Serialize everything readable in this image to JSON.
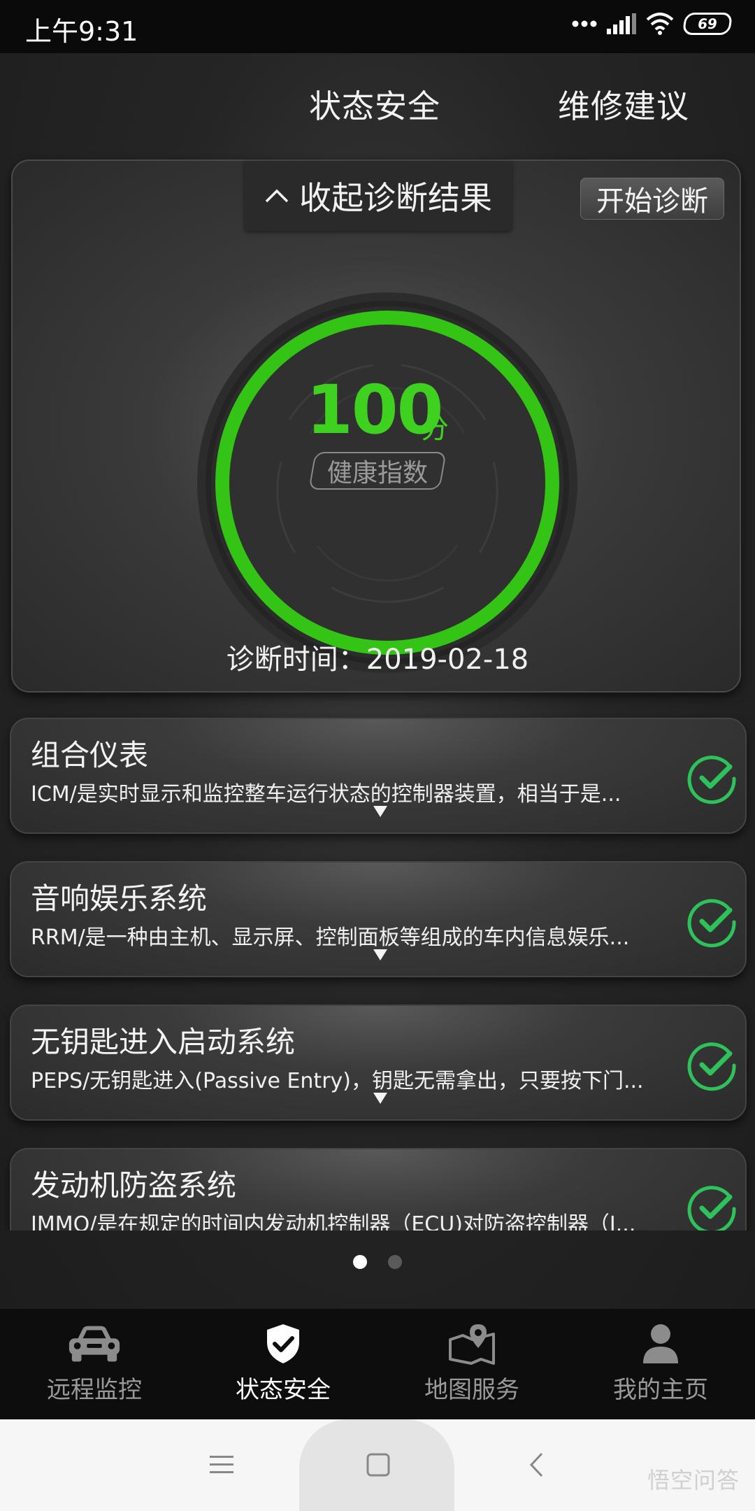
{
  "status_bar": {
    "time": "上午9:31",
    "battery": "69"
  },
  "top_tabs": {
    "status_safety": "状态安全",
    "repair_advice": "维修建议"
  },
  "health": {
    "collapse_label": "收起诊断结果",
    "start_label": "开始诊断",
    "score": "100",
    "score_unit": "分",
    "badge": "健康指数",
    "score_fraction": 1.0,
    "diagnosis_time": "诊断时间：2019-02-18",
    "ring_color": "#33c416"
  },
  "items": [
    {
      "title": "组合仪表",
      "desc": "ICM/是实时显示和监控整车运行状态的控制器装置，相当于是..."
    },
    {
      "title": "音响娱乐系统",
      "desc": "RRM/是一种由主机、显示屏、控制面板等组成的车内信息娱乐..."
    },
    {
      "title": "无钥匙进入启动系统",
      "desc": "PEPS/无钥匙进入(Passive Entry)，钥匙无需拿出，只要按下门..."
    },
    {
      "title": "发动机防盗系统",
      "desc": "IMMO/是在规定的时间内发动机控制器（ECU)对防盗控制器（I..."
    }
  ],
  "pager": {
    "count": 2,
    "active": 0
  },
  "bottom_nav": {
    "items": [
      {
        "label": "远程监控",
        "icon": "car-icon"
      },
      {
        "label": "状态安全",
        "icon": "shield-check-icon"
      },
      {
        "label": "地图服务",
        "icon": "map-pin-icon"
      },
      {
        "label": "我的主页",
        "icon": "person-icon"
      }
    ],
    "active": 1
  },
  "watermark": "悟空问答",
  "colors": {
    "accent_green": "#3fd11f",
    "check_green": "#2ec35a"
  }
}
